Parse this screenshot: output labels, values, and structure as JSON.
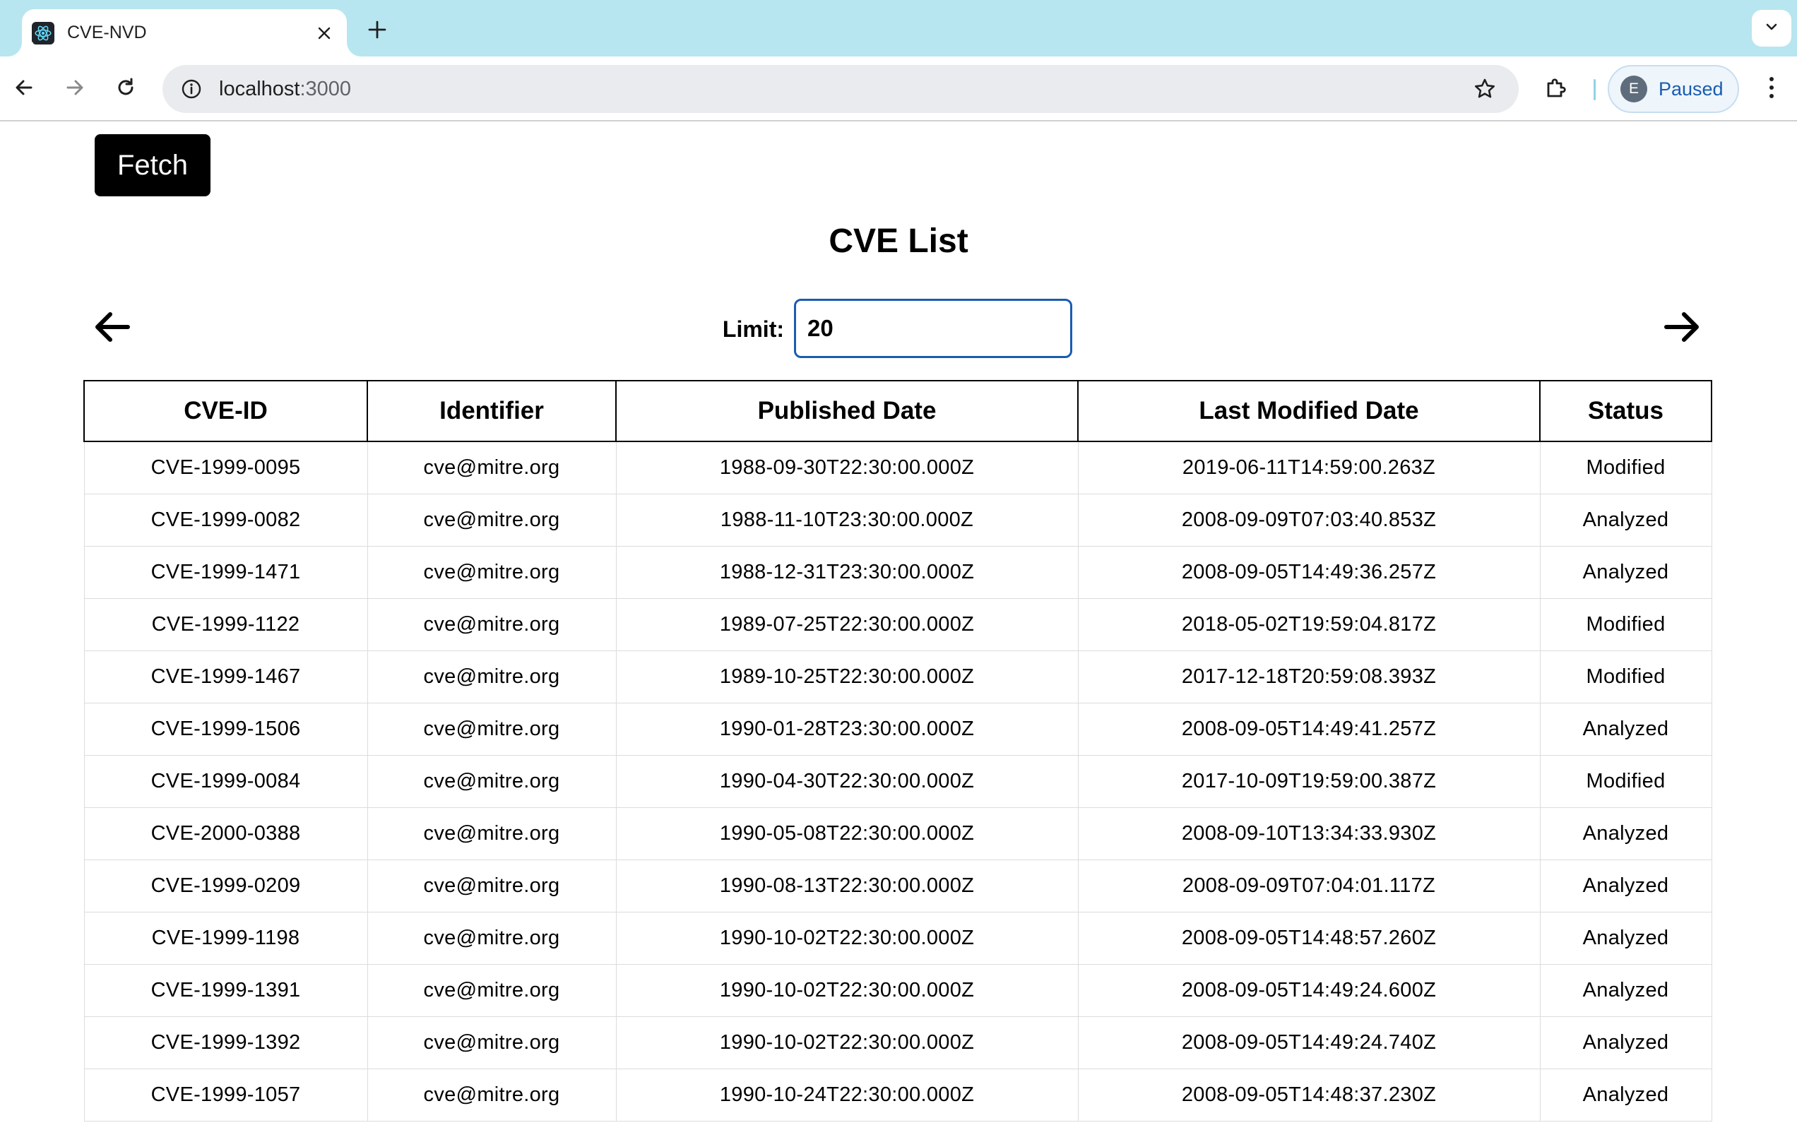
{
  "browser": {
    "tab_title": "CVE-NVD",
    "url_host": "localhost",
    "url_port": ":3000",
    "profile_initial": "E",
    "profile_label": "Paused"
  },
  "page": {
    "fetch_label": "Fetch",
    "title": "CVE List",
    "limit_label": "Limit:",
    "limit_value": "20"
  },
  "table": {
    "headers": [
      "CVE-ID",
      "Identifier",
      "Published Date",
      "Last Modified Date",
      "Status"
    ],
    "rows": [
      [
        "CVE-1999-0095",
        "cve@mitre.org",
        "1988-09-30T22:30:00.000Z",
        "2019-06-11T14:59:00.263Z",
        "Modified"
      ],
      [
        "CVE-1999-0082",
        "cve@mitre.org",
        "1988-11-10T23:30:00.000Z",
        "2008-09-09T07:03:40.853Z",
        "Analyzed"
      ],
      [
        "CVE-1999-1471",
        "cve@mitre.org",
        "1988-12-31T23:30:00.000Z",
        "2008-09-05T14:49:36.257Z",
        "Analyzed"
      ],
      [
        "CVE-1999-1122",
        "cve@mitre.org",
        "1989-07-25T22:30:00.000Z",
        "2018-05-02T19:59:04.817Z",
        "Modified"
      ],
      [
        "CVE-1999-1467",
        "cve@mitre.org",
        "1989-10-25T22:30:00.000Z",
        "2017-12-18T20:59:08.393Z",
        "Modified"
      ],
      [
        "CVE-1999-1506",
        "cve@mitre.org",
        "1990-01-28T23:30:00.000Z",
        "2008-09-05T14:49:41.257Z",
        "Analyzed"
      ],
      [
        "CVE-1999-0084",
        "cve@mitre.org",
        "1990-04-30T22:30:00.000Z",
        "2017-10-09T19:59:00.387Z",
        "Modified"
      ],
      [
        "CVE-2000-0388",
        "cve@mitre.org",
        "1990-05-08T22:30:00.000Z",
        "2008-09-10T13:34:33.930Z",
        "Analyzed"
      ],
      [
        "CVE-1999-0209",
        "cve@mitre.org",
        "1990-08-13T22:30:00.000Z",
        "2008-09-09T07:04:01.117Z",
        "Analyzed"
      ],
      [
        "CVE-1999-1198",
        "cve@mitre.org",
        "1990-10-02T22:30:00.000Z",
        "2008-09-05T14:48:57.260Z",
        "Analyzed"
      ],
      [
        "CVE-1999-1391",
        "cve@mitre.org",
        "1990-10-02T22:30:00.000Z",
        "2008-09-05T14:49:24.600Z",
        "Analyzed"
      ],
      [
        "CVE-1999-1392",
        "cve@mitre.org",
        "1990-10-02T22:30:00.000Z",
        "2008-09-05T14:49:24.740Z",
        "Analyzed"
      ],
      [
        "CVE-1999-1057",
        "cve@mitre.org",
        "1990-10-24T22:30:00.000Z",
        "2008-09-05T14:48:37.230Z",
        "Analyzed"
      ]
    ]
  },
  "colors": {
    "tabstrip": "#b8e6f0",
    "accent": "#1a5cb0",
    "button_bg": "#000000"
  },
  "icons": {
    "favicon": "react-atom-icon",
    "back": "arrow-left-icon",
    "forward": "arrow-right-icon",
    "reload": "reload-icon",
    "site_info": "info-icon",
    "bookmark": "star-icon",
    "extensions": "puzzle-icon",
    "menu": "kebab-menu-icon",
    "prev_page": "arrow-left-icon",
    "next_page": "arrow-right-icon"
  }
}
